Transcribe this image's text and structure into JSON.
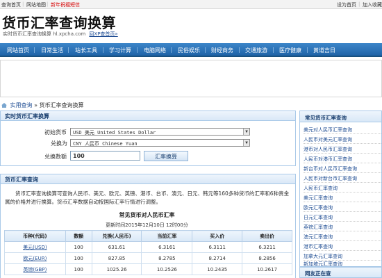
{
  "topbar": {
    "left": [
      "查询首页",
      "网站地图",
      "新年祝福短信"
    ],
    "right": [
      "设为首页",
      "加入收藏"
    ]
  },
  "header": {
    "title": "货币汇率查询换算",
    "subtitle": "实时货币汇率查询换算  hl.xpcha.com",
    "home_link": "回XP查首页»"
  },
  "nav": [
    "网站首页",
    "日常生活",
    "站长工具",
    "学习计算",
    "电脑网络",
    "民俗娱乐",
    "财经商务",
    "交通旅游",
    "医疗健康",
    "黄道吉日"
  ],
  "breadcrumb": {
    "home": "实用查询",
    "sep": "»",
    "current": "货币汇率查询换算"
  },
  "converter": {
    "title": "实时货币汇率换算",
    "from_label": "初始货币",
    "from_value": "USD 美元 United States Dollar",
    "to_label": "兑换为",
    "to_value": "CNY 人民币 Chinese Yuan",
    "amount_label": "兑换数额",
    "amount_value": "100",
    "submit_label": "汇率换算"
  },
  "query": {
    "title": "货币汇率查询",
    "intro": "货币汇率查询换算可查询人民币、美元、欧元、英镑、港币、台币、澳元、日元、韩元等160多种货币的汇率和6种贵金属的价格并进行换算。货币汇率数据自动按国际汇率行情进行调整。",
    "table_title": "常见货币对人民币汇率",
    "updated": "更新时间2015年12月10日  12时00分",
    "columns": [
      "币种(代码)",
      "数额",
      "兑换(人民币)",
      "当前汇率",
      "买入价",
      "卖出价"
    ],
    "rows": [
      [
        "美元(USD)",
        "100",
        "631.61",
        "6.3161",
        "6.3111",
        "6.3211"
      ],
      [
        "欧元(EUR)",
        "100",
        "827.85",
        "8.2785",
        "8.2714",
        "8.2856"
      ],
      [
        "英镑(GBP)",
        "100",
        "1025.26",
        "10.2526",
        "10.2435",
        "10.2617"
      ]
    ]
  },
  "sidebar": {
    "title": "常见货币汇率查询",
    "items": [
      "美元对人民币汇率查询",
      "人民币对美元汇率查询",
      "港币对人民币汇率查询",
      "人民币对港币汇率查询",
      "新台币对人民币汇率查询",
      "人民币对新台币汇率查询",
      "人民币汇率查询",
      "美元汇率查询",
      "欧元汇率查询",
      "日元汇率查询",
      "英镑汇率查询",
      "澳元汇率查询",
      "港币汇率查询",
      "加拿大元汇率查询",
      "新加坡元汇率查询"
    ],
    "second_title": "网友正在查"
  },
  "colors": {
    "nav_bg": "#2a72b8",
    "link": "#1f4d93",
    "accent_red": "#d60000",
    "panel_border": "#a9c9e8"
  }
}
